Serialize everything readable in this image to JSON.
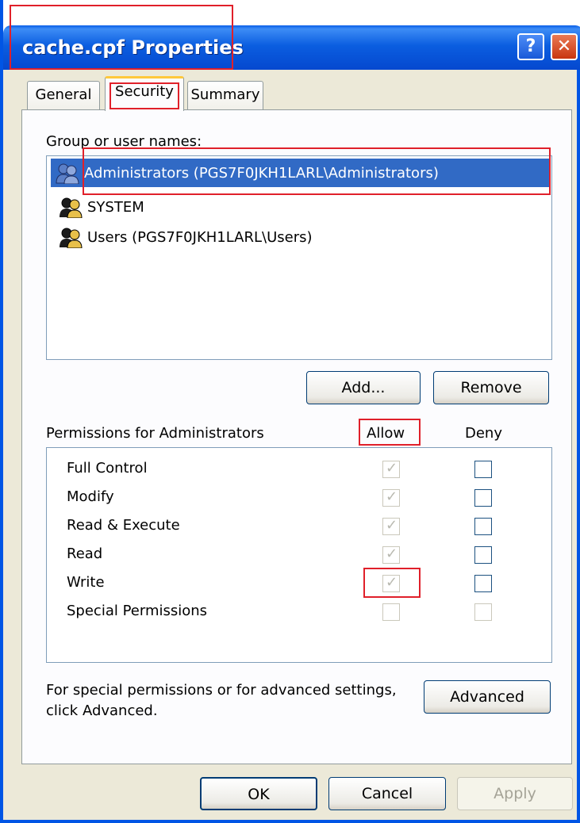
{
  "window": {
    "title": "cache.cpf Properties",
    "help_glyph": "?",
    "close_glyph": "✕"
  },
  "tabs": [
    {
      "label": "General"
    },
    {
      "label": "Security"
    },
    {
      "label": "Summary"
    }
  ],
  "groups": {
    "label": "Group or user names:",
    "items": [
      {
        "name": "Administrators (PGS7F0JKH1LARL\\Administrators)"
      },
      {
        "name": "SYSTEM"
      },
      {
        "name": "Users (PGS7F0JKH1LARL\\Users)"
      }
    ],
    "add_label": "Add...",
    "remove_label": "Remove"
  },
  "permissions": {
    "header": "Permissions for Administrators",
    "allow_header": "Allow",
    "deny_header": "Deny",
    "rows": [
      {
        "name": "Full Control",
        "allow": "✓"
      },
      {
        "name": "Modify",
        "allow": "✓"
      },
      {
        "name": "Read & Execute",
        "allow": "✓"
      },
      {
        "name": "Read",
        "allow": "✓"
      },
      {
        "name": "Write",
        "allow": "✓"
      },
      {
        "name": "Special Permissions",
        "allow": ""
      }
    ]
  },
  "advanced": {
    "text_line1": "For special permissions or for advanced settings,",
    "text_line2": "click Advanced.",
    "button_label": "Advanced"
  },
  "footer": {
    "ok_label": "OK",
    "cancel_label": "Cancel",
    "apply_label": "Apply"
  },
  "colors": {
    "title_blue": "#0548cf",
    "highlight_red": "#e0202a",
    "selection": "#316ac5"
  }
}
